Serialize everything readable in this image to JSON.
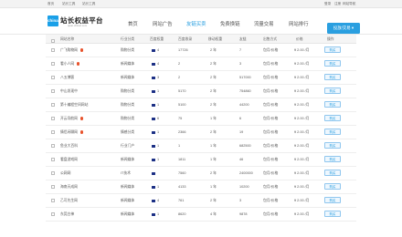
{
  "topbar": {
    "left": [
      "首页",
      "站长工具",
      "站长工具"
    ],
    "right": [
      "登录",
      "注册",
      "网站导航"
    ]
  },
  "header": {
    "logo_badge": "chinaz",
    "logo_text": "站长权益平台",
    "logo_sub": "quan.chinaz.com",
    "nav": [
      "首页",
      "网站广告",
      "友链买卖",
      "免费换链",
      "流量交易",
      "网站排行"
    ],
    "active_nav_index": 2,
    "cta": "投放/交易"
  },
  "table": {
    "headers": [
      "网站名称",
      "行业分类",
      "百度权重",
      "百度收录",
      "移动权重",
      "友链",
      "出售方式",
      "价格",
      "操作"
    ],
    "rows": [
      {
        "name": "广飞购物网",
        "hot": true,
        "industry": "购物分类",
        "br": "4",
        "sl": "17726",
        "mob": "2 年",
        "yl": "7",
        "mode": "包月/价格",
        "price": "¥ 2.00 /月",
        "action": "购买"
      },
      {
        "name": "看小人网",
        "hot": true,
        "industry": "新闻媒体",
        "br": "4",
        "sl": "2",
        "mob": "2 年",
        "yl": "3",
        "mode": "包月/价格",
        "price": "¥ 2.00 /月",
        "action": "购买"
      },
      {
        "name": "八五博客",
        "hot": false,
        "industry": "新闻媒体",
        "br": "3",
        "sl": "2",
        "mob": "2 年",
        "yl": "517000",
        "mode": "包月/价格",
        "price": "¥ 2.00 /月",
        "action": "购买"
      },
      {
        "name": "中山发现中",
        "hot": false,
        "industry": "购物分类",
        "br": "1",
        "sl": "5170",
        "mob": "2 年",
        "yl": "754860",
        "mode": "包月/价格",
        "price": "¥ 2.00 /月",
        "action": "购买"
      },
      {
        "name": "第十编程空间网站",
        "hot": false,
        "industry": "购物分类",
        "br": "1",
        "sl": "5100",
        "mob": "2 年",
        "yl": "44200",
        "mode": "包月/价格",
        "price": "¥ 2.00 /月",
        "action": "购买"
      },
      {
        "name": "开云导航网",
        "hot": true,
        "industry": "购物分类",
        "br": "6",
        "sl": "75",
        "mob": "1 年",
        "yl": "6",
        "mode": "包月/价格",
        "price": "¥ 2.00 /月",
        "action": "购买"
      },
      {
        "name": "情侣闲聊网",
        "hot": true,
        "industry": "情感分类",
        "br": "1",
        "sl": "2366",
        "mob": "2 年",
        "yl": "19",
        "mode": "包月/价格",
        "price": "¥ 2.00 /月",
        "action": "购买"
      },
      {
        "name": "鱼业大百科",
        "hot": false,
        "industry": "行业门户",
        "br": "1",
        "sl": "1",
        "mob": "1 年",
        "yl": "682500",
        "mode": "包月/价格",
        "price": "¥ 2.00 /月",
        "action": "购买"
      },
      {
        "name": "看盘游戏网",
        "hot": false,
        "industry": "新闻媒体",
        "br": "1",
        "sl": "1811",
        "mob": "1 年",
        "yl": "46",
        "mode": "包月/价格",
        "price": "¥ 2.00 /月",
        "action": "购买"
      },
      {
        "name": "公网网",
        "hot": false,
        "industry": "IT技术",
        "br": "",
        "sl": "7560",
        "mob": "2 年",
        "yl": "2400000",
        "mode": "包月/价格",
        "price": "¥ 2.00 /月",
        "action": "购买"
      },
      {
        "name": "海南天成网",
        "hot": false,
        "industry": "新闻媒体",
        "br": "1",
        "sl": "4133",
        "mob": "1 年",
        "yl": "10200",
        "mode": "包月/价格",
        "price": "¥ 2.00 /月",
        "action": "购买"
      },
      {
        "name": "乙可先生网",
        "hot": false,
        "industry": "新闻媒体",
        "br": "4",
        "sl": "761",
        "mob": "2 年",
        "yl": "3",
        "mode": "包月/价格",
        "price": "¥ 2.00 /月",
        "action": "购买"
      },
      {
        "name": "东莞古神",
        "hot": false,
        "industry": "新闻媒体",
        "br": "1",
        "sl": "8620",
        "mob": "4 年",
        "yl": "9878",
        "mode": "包月/价格",
        "price": "¥ 2.00 /月",
        "action": "购买"
      }
    ]
  },
  "colors": {
    "accent": "#2a9fe0",
    "hot": "#e8542d",
    "weight_icon": "#1b2f84"
  }
}
